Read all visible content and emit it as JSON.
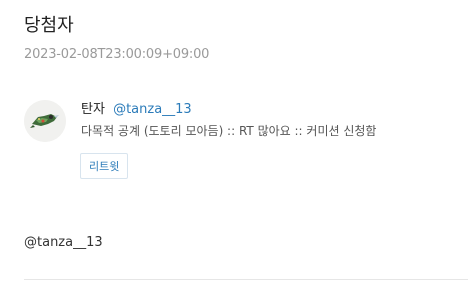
{
  "post": {
    "title": "당첨자",
    "timestamp": "2023-02-08T23:00:09+09:00",
    "mention": "@tanza__13"
  },
  "tweet": {
    "author_name": "탄자",
    "author_handle": "@tanza__13",
    "text": "다목적 공계 (도토리 모아듬) :: RT 많아요 :: 커미션 신청함",
    "retweet_label": "리트윗",
    "avatar_icon": "bird-illustration-avatar"
  },
  "colors": {
    "link": "#2b7bb9",
    "muted": "#9a9a9a"
  }
}
